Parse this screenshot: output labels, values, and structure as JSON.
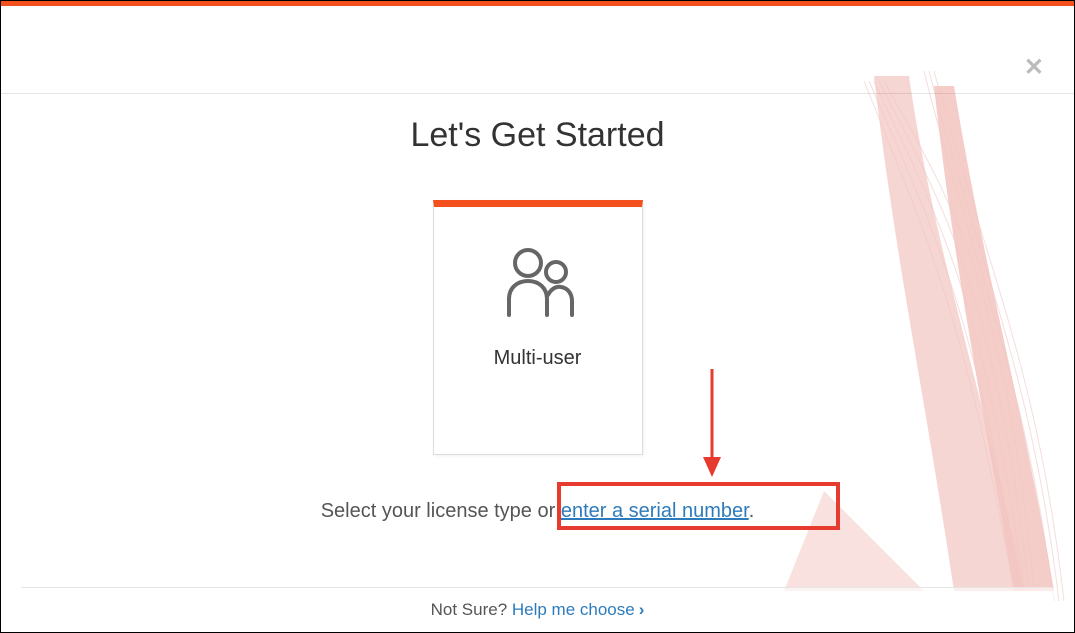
{
  "heading": "Let's Get Started",
  "card": {
    "label": "Multi-user"
  },
  "prompt": {
    "prefix": "Select your license type or ",
    "link": "enter a serial number",
    "suffix": "."
  },
  "footer": {
    "question": "Not Sure? ",
    "link": "Help me choose"
  }
}
